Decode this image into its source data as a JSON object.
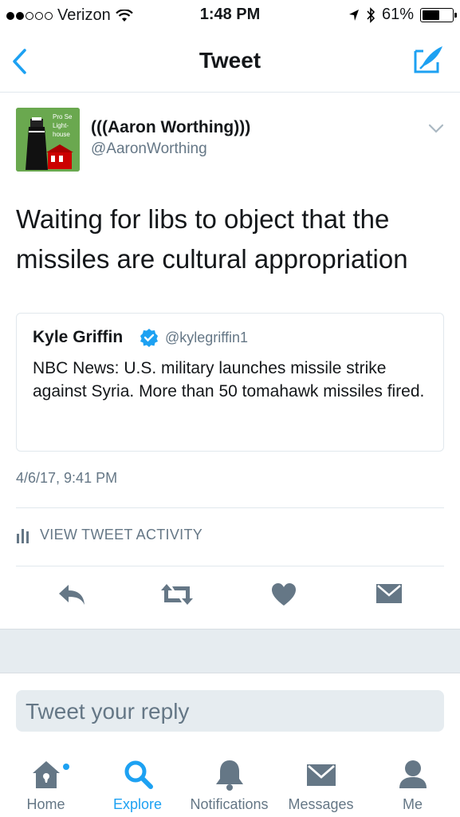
{
  "status_bar": {
    "carrier": "Verizon",
    "time": "1:48 PM",
    "battery": "61%",
    "battery_level": 0.61
  },
  "nav": {
    "title": "Tweet"
  },
  "tweet": {
    "author_name": "(((Aaron Worthing)))",
    "author_handle": "@AaronWorthing",
    "avatar_text": "Pro Se Light-house",
    "text": "Waiting for libs to object that the missiles are cultural appropriation",
    "timestamp": "4/6/17, 9:41 PM"
  },
  "quote": {
    "author_name": "Kyle Griffin",
    "author_handle": "@kylegriffin1",
    "text": "NBC News: U.S. military launches missile strike against Syria. More than 50 tomahawk missiles fired."
  },
  "activity": {
    "label": "VIEW TWEET ACTIVITY"
  },
  "actions": [
    "reply-icon",
    "retweet-icon",
    "like-icon",
    "direct-message-icon"
  ],
  "reply": {
    "placeholder": "Tweet your reply"
  },
  "tabs": [
    {
      "label": "Home",
      "icon": "home-icon",
      "active": false
    },
    {
      "label": "Explore",
      "icon": "search-icon",
      "active": true
    },
    {
      "label": "Notifications",
      "icon": "bell-icon",
      "active": false
    },
    {
      "label": "Messages",
      "icon": "envelope-icon",
      "active": false
    },
    {
      "label": "Me",
      "icon": "person-icon",
      "active": false
    }
  ],
  "colors": {
    "accent": "#1da1f2",
    "secondary_text": "#657786",
    "icon_gray": "#657786",
    "divider": "#e1e8ed",
    "band": "#e6ecf0"
  }
}
